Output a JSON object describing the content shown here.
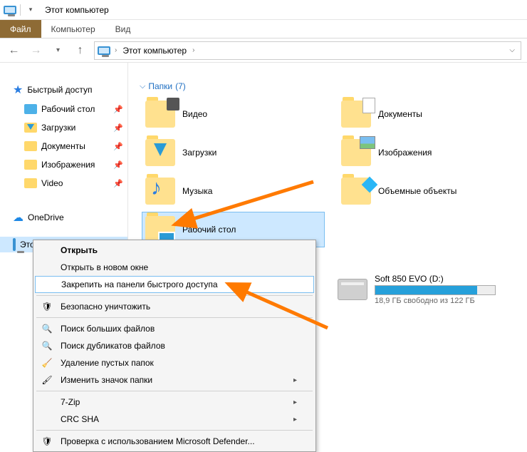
{
  "titlebar": {
    "title": "Этот компьютер"
  },
  "ribbon": {
    "file": "Файл",
    "computer": "Компьютер",
    "view": "Вид"
  },
  "breadcrumb": {
    "root": "Этот компьютер"
  },
  "sidebar": {
    "quick_access": "Быстрый доступ",
    "items": [
      {
        "label": "Рабочий стол",
        "pinned": true
      },
      {
        "label": "Загрузки",
        "pinned": true
      },
      {
        "label": "Документы",
        "pinned": true
      },
      {
        "label": "Изображения",
        "pinned": true
      },
      {
        "label": "Video",
        "pinned": true
      }
    ],
    "onedrive": "OneDrive",
    "this_pc": "Этот компьютер"
  },
  "section_folders": {
    "label": "Папки",
    "count": "(7)"
  },
  "folders": {
    "video": "Видео",
    "documents": "Документы",
    "downloads": "Загрузки",
    "pictures": "Изображения",
    "music": "Музыка",
    "objects3d": "Объемные объекты",
    "desktop": "Рабочий стол"
  },
  "drive": {
    "name": "Soft 850 EVO (D:)",
    "free_text": "18,9 ГБ свободно из 122 ГБ",
    "used_pct": 85
  },
  "context_menu": {
    "open": "Открыть",
    "open_new": "Открыть в новом окне",
    "pin_qa": "Закрепить на панели быстрого доступа",
    "wipe": "Безопасно уничтожить",
    "find_big": "Поиск больших файлов",
    "find_dup": "Поиск дубликатов файлов",
    "del_empty": "Удаление пустых папок",
    "change_icon": "Изменить значок папки",
    "sevenzip": "7-Zip",
    "crc": "CRC SHA",
    "defender": "Проверка с использованием Microsoft Defender..."
  }
}
